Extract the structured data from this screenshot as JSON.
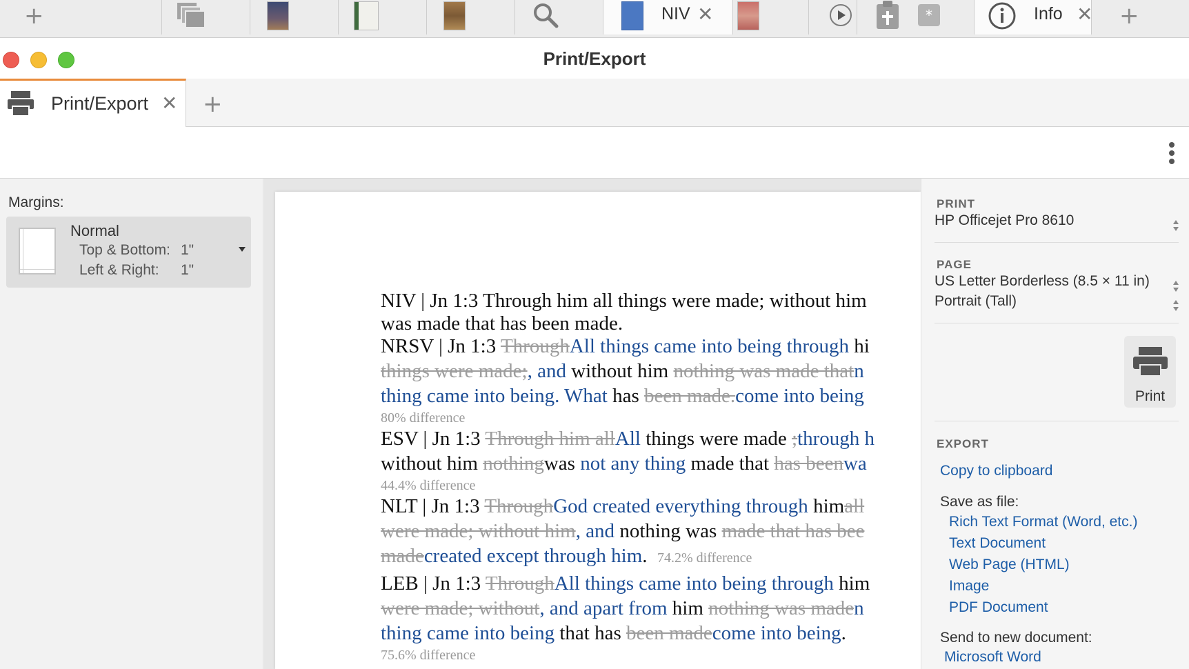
{
  "tabstrip": {
    "niv_label": "NIV",
    "info_label": "Info",
    "colors": {
      "active_tab": "#fbfbfb",
      "inactive_tab": "#ececec"
    }
  },
  "window": {
    "title": "Print/Export"
  },
  "inner_tabs": {
    "label": "Print/Export"
  },
  "margins": {
    "label": "Margins:",
    "preset": "Normal",
    "top_bottom_label": "Top & Bottom:",
    "top_bottom_value": "1\"",
    "left_right_label": "Left & Right:",
    "left_right_value": "1\""
  },
  "document": {
    "niv": {
      "line1": "NIV | Jn 1:3 Through him all things were made; without him",
      "line2": "was made that has been made."
    },
    "nrsv": {
      "prefix": "NRSV | Jn 1:3 ",
      "l1_del": "Through",
      "l1_ins": "All things came into being through",
      "l1_tail": " hi",
      "l2_del": "things were made;",
      "l2_ins": ", and",
      "l2_plain": " without him ",
      "l2_del2": "nothing was made that",
      "l2_ins2": "n",
      "l3_ins": "thing came into being. What",
      "l3_plain": " has ",
      "l3_del": "been made.",
      "l3_ins2": "come into being",
      "diff": "80% difference"
    },
    "esv": {
      "prefix": "ESV | Jn 1:3 ",
      "l1_del": "Through him all",
      "l1_ins": "All",
      "l1_plain": " things were made ",
      "l1_del2": ";",
      "l1_ins2": "through h",
      "l2_plain": "without him ",
      "l2_del": "nothing",
      "l2_plain2": "was ",
      "l2_ins": "not any thing",
      "l2_plain3": " made that ",
      "l2_del2": "has been",
      "l2_ins2": "wa",
      "diff": "44.4% difference"
    },
    "nlt": {
      "prefix": "NLT | Jn 1:3 ",
      "l1_del": "Through",
      "l1_ins": "God created everything through",
      "l1_plain": " him",
      "l1_del2": "all",
      "l2_del": "were made; without him",
      "l2_ins": ", and",
      "l2_plain": " nothing was ",
      "l2_del2": "made that has bee",
      "l3_del": "made",
      "l3_ins": "created except through him",
      "l3_plain": ".",
      "diff": "74.2% difference"
    },
    "leb": {
      "prefix": "LEB | Jn 1:3 ",
      "l1_del": "Through",
      "l1_ins": "All things came into being through",
      "l1_plain": " him",
      "l2_del": "were made; without",
      "l2_ins": ", and apart from",
      "l2_plain": " him ",
      "l2_del2": "nothing was made",
      "l2_ins2": "n",
      "l3_ins": "thing came into being",
      "l3_plain": " that has ",
      "l3_del": "been made",
      "l3_ins2": "come into being",
      "l3_plain2": ".",
      "diff": "75.6% difference"
    }
  },
  "print_panel": {
    "print_heading": "PRINT",
    "printer": "HP Officejet Pro 8610",
    "page_heading": "PAGE",
    "paper": "US Letter Borderless (8.5 × 11 in)",
    "orientation": "Portrait (Tall)",
    "print_button": "Print",
    "export_heading": "EXPORT",
    "copy_clipboard": "Copy to clipboard",
    "save_as_file": "Save as file:",
    "file_options": [
      "Rich Text Format (Word, etc.)",
      "Text Document",
      "Web Page (HTML)",
      "Image",
      "PDF Document"
    ],
    "send_to_doc": "Send to new document:",
    "microsoft_word": "Microsoft Word"
  },
  "colors": {
    "inserted": "#1f4f96",
    "deleted": "#9d9d9d",
    "link": "#1e5ea8",
    "accent_tab": "#e88b3c",
    "close_red": "#ee5d53",
    "minimize_yellow": "#f6bd34",
    "maximize_green": "#5fc641"
  }
}
